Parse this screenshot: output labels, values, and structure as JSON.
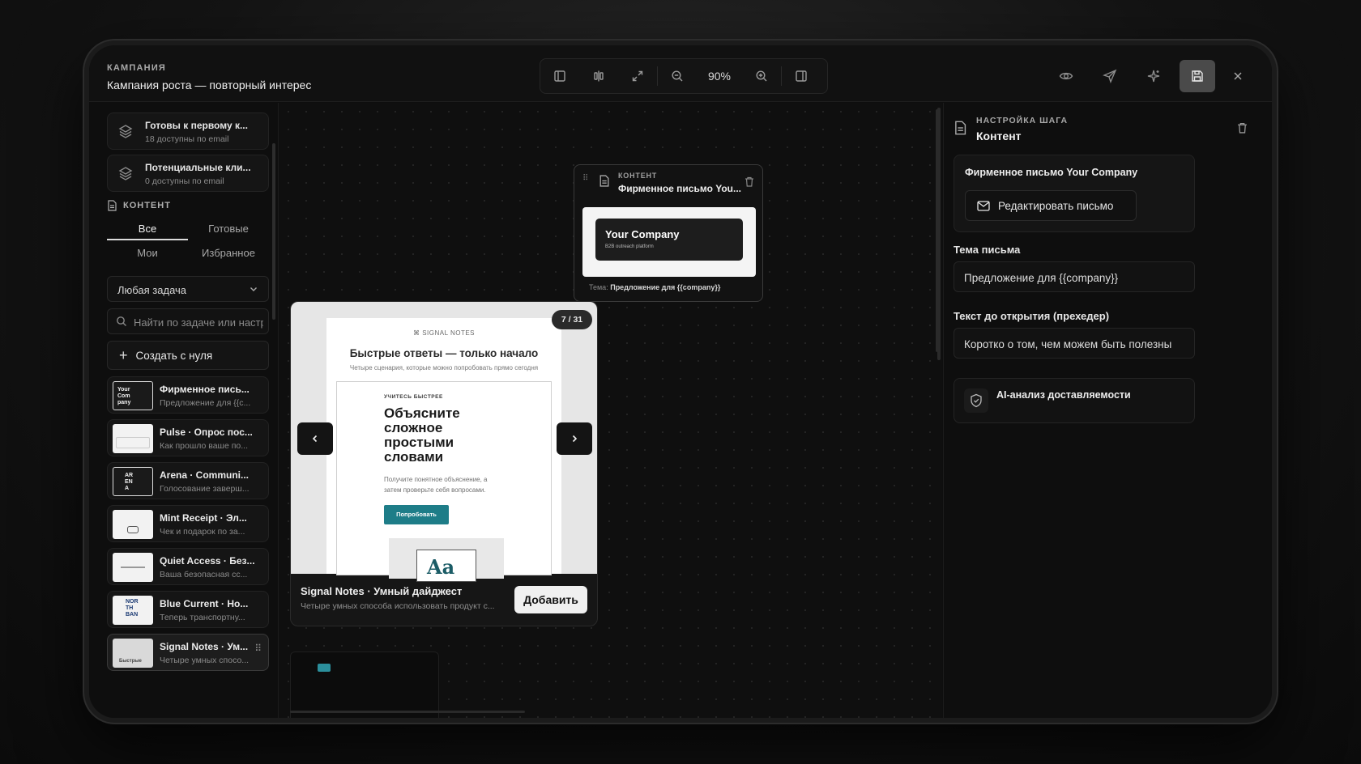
{
  "header": {
    "kicker": "КАМПАНИЯ",
    "title": "Кампания роста — повторный интерес",
    "zoom": "90%"
  },
  "audiences": [
    {
      "title": "Готовы к первому к...",
      "subtitle": "18 доступны по email"
    },
    {
      "title": "Потенциальные кли...",
      "subtitle": "0 доступны по email"
    }
  ],
  "content_section": {
    "label": "КОНТЕНТ",
    "tabs": [
      "Все",
      "Готовые",
      "Мои",
      "Избранное"
    ],
    "active_tab": "Все",
    "task_select": "Любая задача",
    "search_placeholder": "Найти по задаче или настроению",
    "create_label": "Создать с нуля"
  },
  "templates": [
    {
      "title": "Фирменное пись...",
      "subtitle": "Предложение для {{c...",
      "thumb_text": "Your Com pany"
    },
    {
      "title": "Pulse · Опрос пос...",
      "subtitle": "Как прошло ваше по...",
      "thumb_text": ""
    },
    {
      "title": "Arena · Communi...",
      "subtitle": "Голосование заверш...",
      "thumb_text": "AR EN A"
    },
    {
      "title": "Mint Receipt · Эл...",
      "subtitle": "Чек и подарок по за...",
      "thumb_text": ""
    },
    {
      "title": "Quiet Access · Без...",
      "subtitle": "Ваша безопасная сс...",
      "thumb_text": ""
    },
    {
      "title": "Blue Current · Но...",
      "subtitle": "Теперь транспортну...",
      "thumb_text": "NOR TH BAN"
    },
    {
      "title": "Signal Notes · Ум...",
      "subtitle": "Четыре умных спосо...",
      "thumb_text": "Быстрые"
    }
  ],
  "node": {
    "kicker": "КОНТЕНТ",
    "title": "Фирменное письмо You...",
    "preview_title": "Your Company",
    "preview_sub": "B2B outreach platform",
    "subject_label": "Тема:",
    "subject_value": "Предложение для {{company}}"
  },
  "popup": {
    "counter": "7 / 31",
    "mail_brand": "⌘ SIGNAL NOTES",
    "mail_heading": "Быстрые ответы — только начало",
    "mail_sub": "Четыре сценария, которые можно попробовать прямо сегодня",
    "card_kicker": "УЧИТЕСЬ БЫСТРЕЕ",
    "card_title": "Объясните сложное простыми словами",
    "card_text": "Получите понятное объяснение, а затем проверьте себя вопросами.",
    "card_button": "Попробовать",
    "card_image_text": "Aa",
    "footer_title": "Signal Notes · Умный дайджест",
    "footer_subtitle": "Четыре умных способа использовать продукт с...",
    "add_label": "Добавить"
  },
  "right_panel": {
    "kicker": "НАСТРОЙКА ШАГА",
    "title": "Контент",
    "card_title": "Фирменное письмо Your Company",
    "edit_button": "Редактировать письмо",
    "subject_label": "Тема письма",
    "subject_value": "Предложение для {{company}}",
    "preheader_label": "Текст до открытия (прехедер)",
    "preheader_value": "Коротко о том, чем можем быть полезны",
    "ai_title": "AI-анализ доставляемости"
  },
  "colors": {
    "accent_teal": "#1e7d88",
    "background": "#0e0e0e"
  }
}
